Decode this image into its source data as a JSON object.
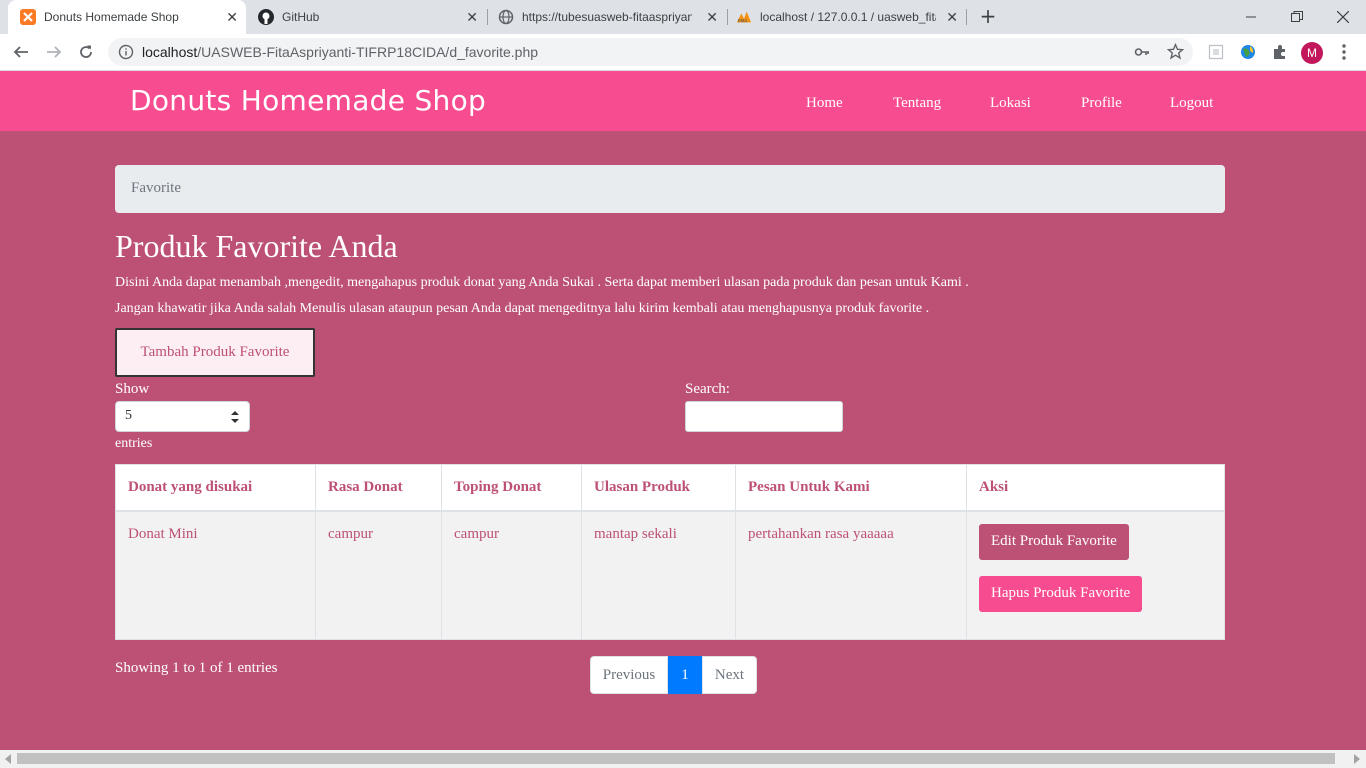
{
  "browser": {
    "tabs": [
      {
        "title": "Donuts Homemade Shop",
        "icon": "xampp-icon"
      },
      {
        "title": "GitHub",
        "icon": "github-icon"
      },
      {
        "title": "https://tubesuasweb-fitaaspriyan",
        "icon": "globe-icon"
      },
      {
        "title": "localhost / 127.0.0.1 / uasweb_fita",
        "icon": "phpmyadmin-icon"
      }
    ],
    "url_host": "localhost",
    "url_path": "/UASWEB-FitaAspriyanti-TIFRP18CIDA/d_favorite.php",
    "profile_initial": "M"
  },
  "site": {
    "brand": "Donuts Homemade Shop",
    "nav": [
      "Home",
      "Tentang",
      "Lokasi",
      "Profile",
      "Logout"
    ]
  },
  "breadcrumb": "Favorite",
  "page": {
    "title": "Produk Favorite Anda",
    "desc1": "Disini Anda dapat menambah ,mengedit, mengahapus produk donat yang Anda Sukai . Serta dapat memberi ulasan pada produk dan pesan untuk Kami .",
    "desc2": "Jangan khawatir jika Anda salah Menulis ulasan ataupun pesan Anda dapat mengeditnya lalu kirim kembali atau menghapusnya produk favorite .",
    "add_button": "Tambah Produk Favorite"
  },
  "datatable": {
    "show_label": "Show",
    "entries_value": "5",
    "entries_label": "entries",
    "search_label": "Search:",
    "columns": [
      "Donat yang disukai",
      "Rasa Donat",
      "Toping Donat",
      "Ulasan Produk",
      "Pesan Untuk Kami",
      "Aksi"
    ],
    "rows": [
      {
        "donat": "Donat Mini",
        "rasa": "campur",
        "toping": "campur",
        "ulasan": "mantap sekali",
        "pesan": "pertahankan rasa yaaaaa"
      }
    ],
    "edit_label": "Edit Produk Favorite",
    "delete_label": "Hapus Produk Favorite",
    "info": "Showing 1 to 1 of 1 entries",
    "prev": "Previous",
    "page": "1",
    "next": "Next"
  },
  "colors": {
    "background": "#bd5175",
    "navbar": "#f74c8f",
    "pager_active": "#007bff"
  }
}
